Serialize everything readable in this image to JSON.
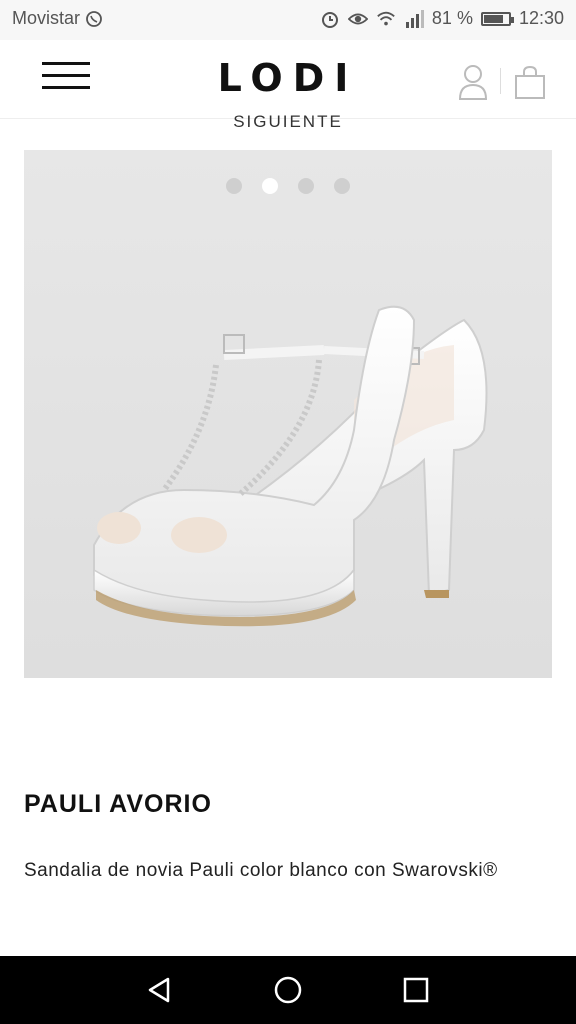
{
  "status_bar": {
    "carrier": "Movistar",
    "battery_percent": "81 %",
    "time": "12:30",
    "battery_level": 0.81,
    "icons": [
      "whatsapp-icon",
      "alarm-icon",
      "eye-icon",
      "wifi-icon",
      "signal-icon",
      "battery-icon"
    ]
  },
  "header": {
    "logo": "LODI",
    "icons": [
      "menu-icon",
      "user-icon",
      "shopping-bag-icon"
    ]
  },
  "carousel": {
    "top_label": "SIGUIENTE",
    "slide_count": 4,
    "active_index": 1
  },
  "product": {
    "name": "PAULI AVORIO",
    "description": "Sandalia de novia Pauli color blanco con Swarovski®"
  },
  "nav_bar": {
    "icons": [
      "back-icon",
      "home-icon",
      "recents-icon"
    ]
  },
  "colors": {
    "status_bar_bg": "#f7f7f7",
    "image_bg": "#e3e3e3",
    "nav_bar_bg": "#000000"
  }
}
